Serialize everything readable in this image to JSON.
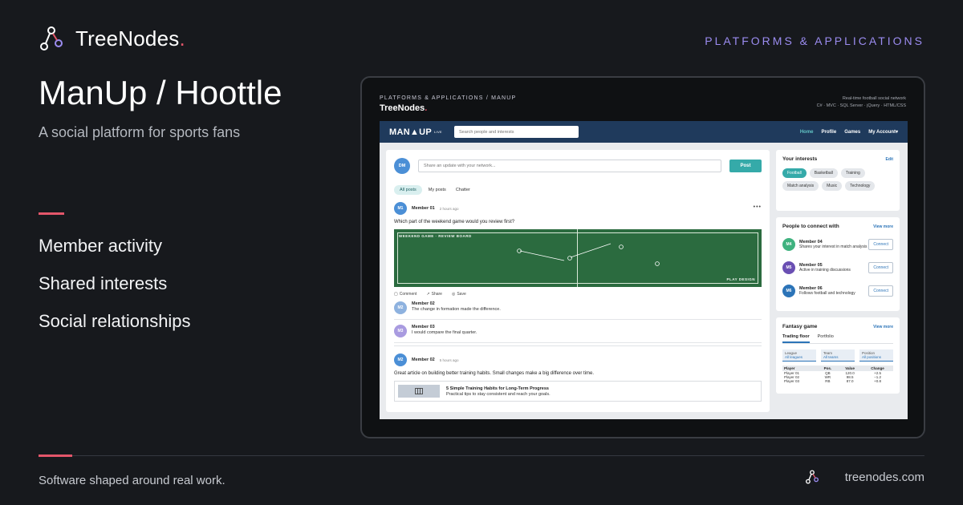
{
  "brand": {
    "name": "TreeNodes",
    "dot": "."
  },
  "top_tag": "PLATFORMS & APPLICATIONS",
  "title": "ManUp / Hoottle",
  "subtitle": "A social platform for sports fans",
  "features": [
    "Member activity",
    "Shared interests",
    "Social relationships"
  ],
  "footer": {
    "tagline": "Software shaped around real work.",
    "url": "treenodes.com"
  },
  "device": {
    "crumb": "PLATFORMS & APPLICATIONS / MANUP",
    "brand": "TreeNodes",
    "desc": "Real-time football social network",
    "stack": "C# · MVC · SQL Server · jQuery · HTML/CSS"
  },
  "app": {
    "logo": "MAN▲UP",
    "logo_sub": "LIVE",
    "search_placeholder": "Search people and interests",
    "nav": [
      "Home",
      "Profile",
      "Games",
      "My Account▾"
    ],
    "composer": {
      "avatar": "DM",
      "placeholder": "Share an update with your network...",
      "post": "Post"
    },
    "feed_tabs": [
      "All posts",
      "My posts",
      "Chatter"
    ],
    "post1": {
      "avatar": "M1",
      "author": "Member 01",
      "time": "2 hours ago",
      "more": "•••",
      "text": "Which part of the weekend game would you review first?",
      "board_label": "WEEKEND GAME · REVIEW BOARD",
      "board_corner": "PLAY DESIGN"
    },
    "actions": [
      "Comment",
      "Share",
      "Save"
    ],
    "comments": [
      {
        "avatar": "M2",
        "name": "Member 02",
        "text": "The change in formation made the difference."
      },
      {
        "avatar": "M3",
        "name": "Member 03",
        "text": "I would compare the final quarter."
      }
    ],
    "post2": {
      "avatar": "M2",
      "author": "Member 02",
      "time": "5 hours ago",
      "text": "Great article on building better training habits. Small changes make a big difference over time.",
      "link_title": "5 Simple Training Habits for Long-Term Progress",
      "link_desc": "Practical tips to stay consistent and reach your goals."
    },
    "interests": {
      "title": "Your interests",
      "edit": "Edit",
      "chips": [
        "Football",
        "Basketball",
        "Training",
        "Match analysis",
        "Music",
        "Technology"
      ]
    },
    "people": {
      "title": "People to connect with",
      "more": "View more",
      "connect": "Connect",
      "list": [
        {
          "avatar": "M4",
          "name": "Member 04",
          "desc": "Shares your interest in match analysis",
          "color": "#3fb27f"
        },
        {
          "avatar": "M5",
          "name": "Member 05",
          "desc": "Active in training discussions",
          "color": "#6a4fb3"
        },
        {
          "avatar": "M6",
          "name": "Member 06",
          "desc": "Follows football and technology",
          "color": "#2c74b8"
        }
      ]
    },
    "fantasy": {
      "title": "Fantasy game",
      "more": "View more",
      "tabs": [
        "Trading floor",
        "Portfolio"
      ],
      "filters": [
        {
          "label": "League",
          "value": "All leagues"
        },
        {
          "label": "Team",
          "value": "All teams"
        },
        {
          "label": "Position",
          "value": "All positions"
        }
      ],
      "columns": [
        "Player",
        "Pos.",
        "Value",
        "Change"
      ],
      "rows": [
        [
          "Player 01",
          "QB",
          "120.0",
          "+2.5"
        ],
        [
          "Player 02",
          "WR",
          "98.5",
          "−1.2"
        ],
        [
          "Player 03",
          "RB",
          "87.0",
          "+0.8"
        ]
      ]
    }
  },
  "colors": {
    "accent": "#e4566a",
    "tag": "#9b8cf0",
    "teal": "#35aaa9",
    "navbar": "#1f3a5c"
  }
}
